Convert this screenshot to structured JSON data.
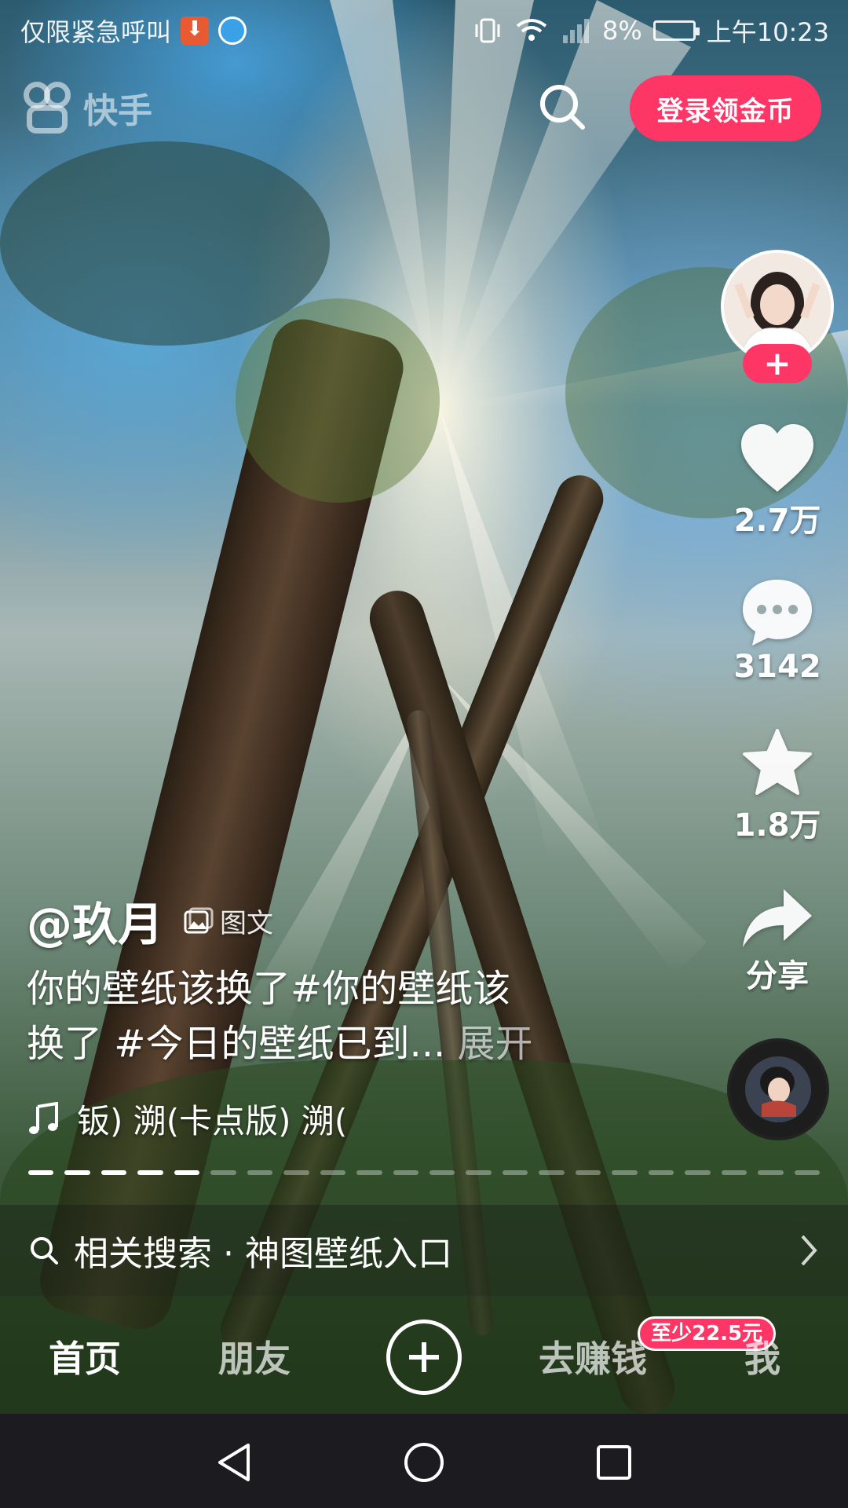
{
  "status_bar": {
    "carrier_text": "仅限紧急呼叫",
    "battery_percent": "8%",
    "time": "上午10:23"
  },
  "top_bar": {
    "logo_text": "快手",
    "login_button": "登录领金币"
  },
  "actions": {
    "like_count": "2.7万",
    "comment_count": "3142",
    "collect_count": "1.8万",
    "share_label": "分享",
    "follow_symbol": "+"
  },
  "post": {
    "author": "@玖月",
    "type_tag": "图文",
    "caption_line1": "你的壁纸该换了#你的壁纸该",
    "caption_line2": "换了 #今日的壁纸已到... ",
    "expand": "展开",
    "music_text": "钣)    溯(卡点版)    溯(",
    "slides_total": 22,
    "slides_viewed": 5
  },
  "related_search": {
    "text": "相关搜索 · 神图壁纸入口"
  },
  "tab_bar": {
    "home": "首页",
    "friends": "朋友",
    "earn": "去赚钱",
    "earn_badge": "至少22.5元",
    "me": "我"
  },
  "colors": {
    "accent": "#fe3666",
    "nav_bg": "#1c1c20"
  },
  "icons": [
    "download-icon",
    "app-icon",
    "vibrate-icon",
    "wifi-icon",
    "signal-icon",
    "battery-icon",
    "kuaishou-logo-icon",
    "search-icon",
    "heart-icon",
    "comment-icon",
    "star-icon",
    "share-icon",
    "image-icon",
    "music-note-icon",
    "chevron-right-icon",
    "back-icon",
    "home-circle-icon",
    "recents-icon"
  ]
}
